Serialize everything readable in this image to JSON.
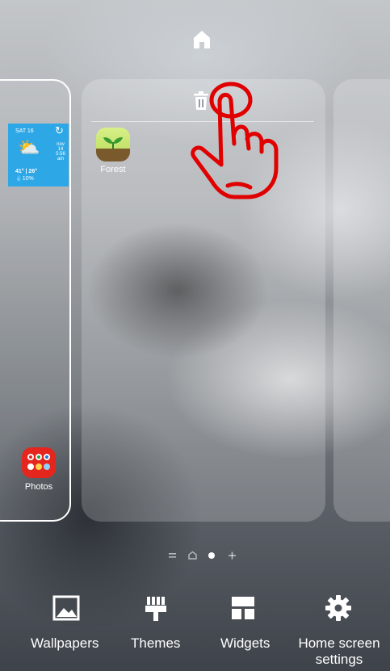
{
  "left_page": {
    "weather": {
      "day": "SAT 16",
      "side_lines": [
        "nov",
        "14",
        "5:56",
        "am"
      ],
      "temps": "41° | 26°",
      "rain": "10%"
    },
    "apps": [
      {
        "label": "Photos",
        "icon": "photos-folder-icon"
      }
    ]
  },
  "main_page": {
    "apps": [
      {
        "label": "Forest",
        "icon": "forest-app-icon"
      }
    ]
  },
  "page_indicator": {
    "current": 2,
    "symbols": [
      "=",
      "⌂",
      "●",
      "+"
    ]
  },
  "toolbar": {
    "wallpapers": "Wallpapers",
    "themes": "Themes",
    "widgets": "Widgets",
    "settings_line1": "Home screen",
    "settings_line2": "settings"
  },
  "colors": {
    "weather_bg": "#2ea7e6",
    "photos_bg": "#e5261f",
    "hand_outline": "#e00000"
  }
}
